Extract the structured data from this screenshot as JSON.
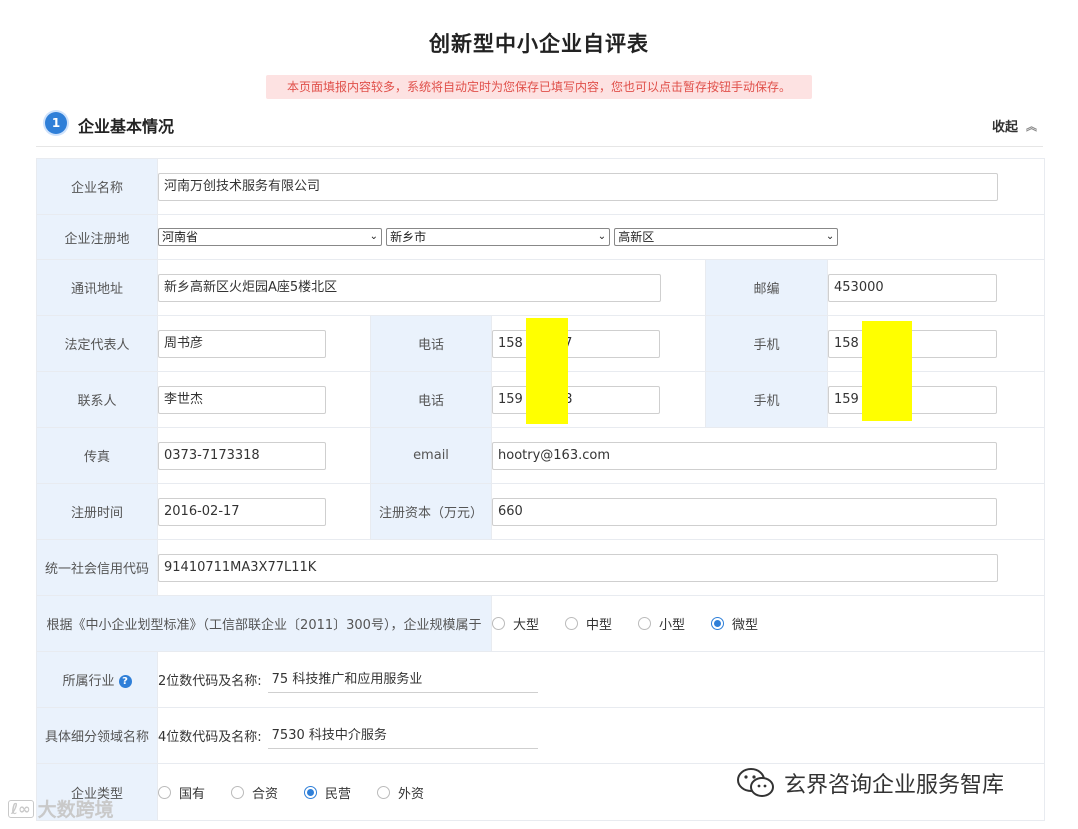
{
  "page": {
    "title": "创新型中小企业自评表",
    "notice": "本页面填报内容较多，系统将自动定时为您保存已填写内容，您也可以点击暂存按钮手动保存。"
  },
  "section": {
    "number": "1",
    "title": "企业基本情况",
    "collapse_label": "收起"
  },
  "form": {
    "company_name": {
      "label": "企业名称",
      "value": "河南万创技术服务有限公司"
    },
    "registered_place": {
      "label": "企业注册地",
      "province": "河南省",
      "city": "新乡市",
      "district": "高新区"
    },
    "address": {
      "label": "通讯地址",
      "value": "新乡高新区火炬园A座5楼北区"
    },
    "postcode": {
      "label": "邮编",
      "value": "453000"
    },
    "legal_rep": {
      "label": "法定代表人",
      "value": "周书彦"
    },
    "legal_rep_phone": {
      "label": "电话",
      "value": "158      027"
    },
    "legal_rep_mobile": {
      "label": "手机",
      "value": "158      27"
    },
    "contact": {
      "label": "联系人",
      "value": "李世杰"
    },
    "contact_phone": {
      "label": "电话",
      "value": "159      338"
    },
    "contact_mobile": {
      "label": "手机",
      "value": "159      38"
    },
    "fax": {
      "label": "传真",
      "value": "0373-7173318"
    },
    "email": {
      "label": "email",
      "value": "hootry@163.com"
    },
    "reg_date": {
      "label": "注册时间",
      "value": "2016-02-17"
    },
    "reg_capital": {
      "label": "注册资本（万元）",
      "value": "660"
    },
    "credit_code": {
      "label": "统一社会信用代码",
      "value": "91410711MA3X77L11K"
    },
    "scale": {
      "label": "根据《中小企业划型标准》（工信部联企业〔2011〕300号），企业规模属于",
      "options": [
        "大型",
        "中型",
        "小型",
        "微型"
      ],
      "selected": "微型"
    },
    "industry": {
      "label": "所属行业",
      "help_icon": "?",
      "prefix": "2位数代码及名称:",
      "value": "75 科技推广和应用服务业"
    },
    "subfield": {
      "label": "具体细分领域名称",
      "prefix": "4位数代码及名称:",
      "value": "7530 科技中介服务"
    },
    "company_type": {
      "label": "企业类型",
      "options": [
        "国有",
        "合资",
        "民营",
        "外资"
      ],
      "selected": "民营"
    }
  },
  "watermarks": {
    "left": "大数跨境",
    "right": "玄界咨询企业服务智库"
  },
  "colors": {
    "accent": "#2f7fd8",
    "label_bg": "#eaf2fc",
    "notice_bg": "#fde2e2",
    "notice_text": "#e0504a",
    "redaction": "#ffff00"
  }
}
